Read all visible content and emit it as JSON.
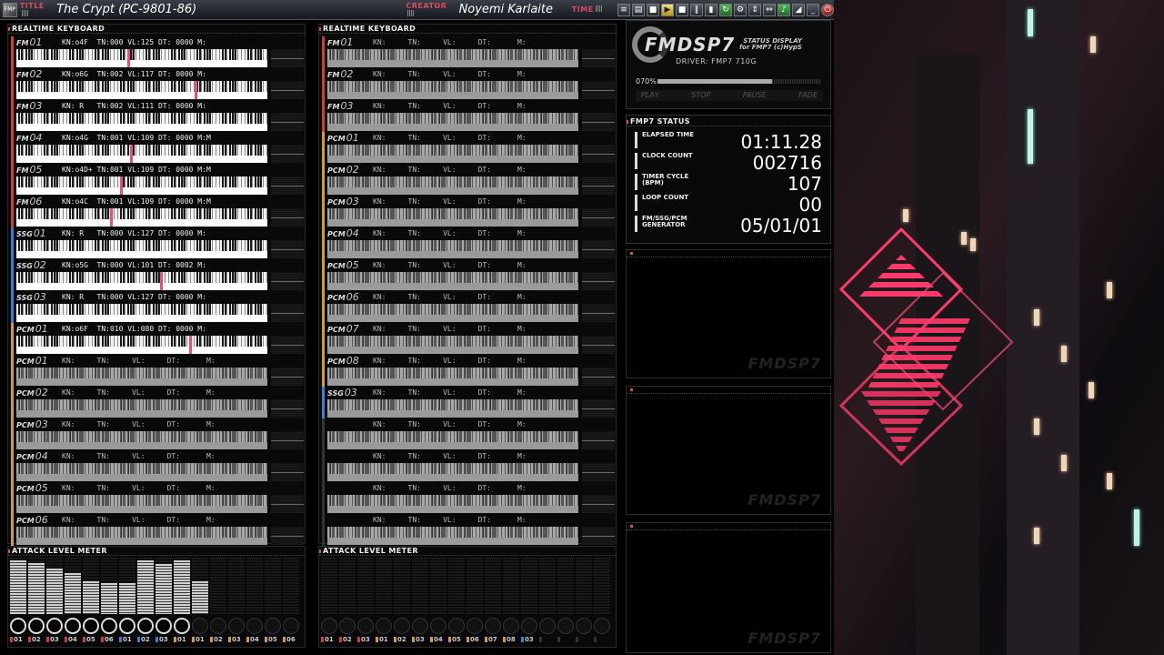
{
  "titlebar": {
    "logo": "FMP",
    "title_label": "TITLE",
    "title": "The Crypt (PC-9801-86)",
    "creator_label": "CREATOR",
    "creator": "Noyemi Karlaite",
    "time_label": "TIME"
  },
  "left_keyboard": {
    "header": "REALTIME KEYBOARD",
    "channels": [
      {
        "type": "FM",
        "num": "01",
        "info": "KN:o4F  TN:000 VL:125 DT: 0000 M:",
        "color": "#d33a3a",
        "hit": 0.45,
        "dim": false
      },
      {
        "type": "FM",
        "num": "02",
        "info": "KN:o6G  TN:002 VL:117 DT: 0000 M:",
        "color": "#d33a3a",
        "hit": 0.72,
        "dim": false
      },
      {
        "type": "FM",
        "num": "03",
        "info": "KN: R   TN:002 VL:111 DT: 0000 M:",
        "color": "#d33a3a",
        "hit": null,
        "dim": false
      },
      {
        "type": "FM",
        "num": "04",
        "info": "KN:o4G  TN:001 VL:109 DT: 0000 M:M",
        "color": "#d33a3a",
        "hit": 0.46,
        "dim": false
      },
      {
        "type": "FM",
        "num": "05",
        "info": "KN:o4D+ TN:001 VL:109 DT: 0000 M:M",
        "color": "#d33a3a",
        "hit": 0.42,
        "dim": false
      },
      {
        "type": "FM",
        "num": "06",
        "info": "KN:o4C  TN:001 VL:109 DT: 0000 M:M",
        "color": "#d33a3a",
        "hit": 0.38,
        "dim": false
      },
      {
        "type": "SSG",
        "num": "01",
        "info": "KN: R   TN:000 VL:127 DT: 0000 M:",
        "color": "#3a7fd3",
        "hit": null,
        "dim": false
      },
      {
        "type": "SSG",
        "num": "02",
        "info": "KN:o5G  TN:000 VL:101 DT: 0002 M:",
        "color": "#3a7fd3",
        "hit": 0.58,
        "dim": false
      },
      {
        "type": "SSG",
        "num": "03",
        "info": "KN: R   TN:000 VL:127 DT: 0000 M:",
        "color": "#3a7fd3",
        "hit": null,
        "dim": false
      },
      {
        "type": "PCM",
        "num": "01",
        "info": "KN:o6F  TN:010 VL:080 DT: 0000 M:",
        "color": "#d39a3a",
        "hit": 0.7,
        "dim": false
      },
      {
        "type": "PCM",
        "num": "01",
        "info": "KN:     TN:     VL:     DT:      M:",
        "color": "#d39a3a",
        "hit": null,
        "dim": true
      },
      {
        "type": "PCM",
        "num": "02",
        "info": "KN:     TN:     VL:     DT:      M:",
        "color": "#d39a3a",
        "hit": null,
        "dim": true
      },
      {
        "type": "PCM",
        "num": "03",
        "info": "KN:     TN:     VL:     DT:      M:",
        "color": "#d39a3a",
        "hit": null,
        "dim": true
      },
      {
        "type": "PCM",
        "num": "04",
        "info": "KN:     TN:     VL:     DT:      M:",
        "color": "#d39a3a",
        "hit": null,
        "dim": true
      },
      {
        "type": "PCM",
        "num": "05",
        "info": "KN:     TN:     VL:     DT:      M:",
        "color": "#d39a3a",
        "hit": null,
        "dim": true
      },
      {
        "type": "PCM",
        "num": "06",
        "info": "KN:     TN:     VL:     DT:      M:",
        "color": "#d39a3a",
        "hit": null,
        "dim": true
      }
    ]
  },
  "right_keyboard": {
    "header": "REALTIME KEYBOARD",
    "channels": [
      {
        "type": "FM",
        "num": "01",
        "info": "KN:     TN:     VL:     DT:      M:",
        "color": "#d33a3a",
        "dim": true
      },
      {
        "type": "FM",
        "num": "02",
        "info": "KN:     TN:     VL:     DT:      M:",
        "color": "#d33a3a",
        "dim": true
      },
      {
        "type": "FM",
        "num": "03",
        "info": "KN:     TN:     VL:     DT:      M:",
        "color": "#d33a3a",
        "dim": true
      },
      {
        "type": "PCM",
        "num": "01",
        "info": "KN:     TN:     VL:     DT:      M:",
        "color": "#d39a3a",
        "dim": true
      },
      {
        "type": "PCM",
        "num": "02",
        "info": "KN:     TN:     VL:     DT:      M:",
        "color": "#d39a3a",
        "dim": true
      },
      {
        "type": "PCM",
        "num": "03",
        "info": "KN:     TN:     VL:     DT:      M:",
        "color": "#d39a3a",
        "dim": true
      },
      {
        "type": "PCM",
        "num": "04",
        "info": "KN:     TN:     VL:     DT:      M:",
        "color": "#d39a3a",
        "dim": true
      },
      {
        "type": "PCM",
        "num": "05",
        "info": "KN:     TN:     VL:     DT:      M:",
        "color": "#d39a3a",
        "dim": true
      },
      {
        "type": "PCM",
        "num": "06",
        "info": "KN:     TN:     VL:     DT:      M:",
        "color": "#d39a3a",
        "dim": true
      },
      {
        "type": "PCM",
        "num": "07",
        "info": "KN:     TN:     VL:     DT:      M:",
        "color": "#d39a3a",
        "dim": true
      },
      {
        "type": "PCM",
        "num": "08",
        "info": "KN:     TN:     VL:     DT:      M:",
        "color": "#d39a3a",
        "dim": true
      },
      {
        "type": "SSG",
        "num": "03",
        "info": "KN:     TN:     VL:     DT:      M:",
        "color": "#3a7fd3",
        "dim": true
      },
      {
        "type": "",
        "num": "",
        "info": "KN:     TN:     VL:     DT:      M:",
        "color": "#333",
        "dim": true
      },
      {
        "type": "",
        "num": "",
        "info": "KN:     TN:     VL:     DT:      M:",
        "color": "#333",
        "dim": true
      },
      {
        "type": "",
        "num": "",
        "info": "KN:     TN:     VL:     DT:      M:",
        "color": "#333",
        "dim": true
      },
      {
        "type": "",
        "num": "",
        "info": "KN:     TN:     VL:     DT:      M:",
        "color": "#333",
        "dim": true
      }
    ]
  },
  "left_meter": {
    "header": "ATTACK LEVEL METER",
    "levels": [
      0.95,
      0.9,
      0.8,
      0.72,
      0.58,
      0.55,
      0.55,
      0.95,
      0.88,
      0.95,
      0.58,
      0,
      0,
      0,
      0,
      0
    ],
    "active": [
      true,
      true,
      true,
      true,
      true,
      true,
      true,
      true,
      true,
      true,
      false,
      false,
      false,
      false,
      false,
      false
    ],
    "labels": [
      "01",
      "02",
      "03",
      "04",
      "05",
      "06",
      "01",
      "02",
      "03",
      "01",
      "01",
      "02",
      "03",
      "04",
      "05",
      "06"
    ],
    "label_colors": [
      "#d33a3a",
      "#d33a3a",
      "#d33a3a",
      "#d33a3a",
      "#d33a3a",
      "#d33a3a",
      "#3a7fd3",
      "#3a7fd3",
      "#3a7fd3",
      "#d39a3a",
      "#d39a3a",
      "#d39a3a",
      "#d39a3a",
      "#d39a3a",
      "#d39a3a",
      "#d39a3a"
    ]
  },
  "right_meter": {
    "header": "ATTACK LEVEL METER",
    "levels": [
      0,
      0,
      0,
      0,
      0,
      0,
      0,
      0,
      0,
      0,
      0,
      0,
      0,
      0,
      0,
      0
    ],
    "active": [
      false,
      false,
      false,
      false,
      false,
      false,
      false,
      false,
      false,
      false,
      false,
      false,
      false,
      false,
      false,
      false
    ],
    "labels": [
      "01",
      "02",
      "03",
      "01",
      "02",
      "03",
      "04",
      "05",
      "06",
      "07",
      "08",
      "03",
      "",
      "",
      "",
      ""
    ],
    "label_colors": [
      "#d33a3a",
      "#d33a3a",
      "#d33a3a",
      "#d39a3a",
      "#d39a3a",
      "#d39a3a",
      "#d39a3a",
      "#d39a3a",
      "#d39a3a",
      "#d39a3a",
      "#d39a3a",
      "#3a7fd3",
      "#333",
      "#333",
      "#333",
      "#333"
    ]
  },
  "fmdsp": {
    "logo": "FMDSP7",
    "subtitle_1": "STATUS DISPLAY",
    "subtitle_2": "for FMP7 (c)HypS",
    "driver": "DRIVER: FMP7  710G",
    "progress_label": "070%",
    "progress": 0.7,
    "controls": [
      "PLAY",
      "STOP",
      "PAUSE",
      "FADE"
    ]
  },
  "status": {
    "header": "FMP7 STATUS",
    "rows": [
      {
        "label": "ELAPSED TIME",
        "value": "01:11.28"
      },
      {
        "label": "CLOCK COUNT",
        "value": "002716"
      },
      {
        "label": "TIMER CYCLE\n(BPM)",
        "value": "107"
      },
      {
        "label": "LOOP COUNT",
        "value": "00"
      },
      {
        "label": "FM/SSG/PCM\nGENERATOR",
        "value": "05/01/01"
      }
    ]
  },
  "subpanels": {
    "watermark": "FMDSP7"
  }
}
